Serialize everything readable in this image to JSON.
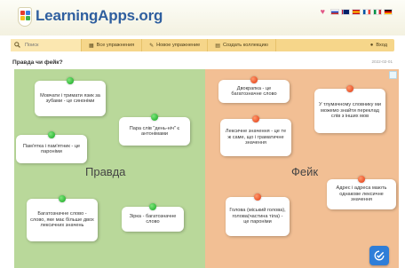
{
  "header": {
    "logo_text": "LearningApps.org",
    "languages": [
      "ru",
      "en",
      "es",
      "fr",
      "it",
      "de"
    ]
  },
  "toolbar": {
    "search_placeholder": "Поиск",
    "all_exercises": "Все упражнения",
    "new_exercise": "Новое упражнение",
    "create_collection": "Создать коллекцию",
    "login": "Вход"
  },
  "page": {
    "title": "Правда чи фейк?",
    "date": "2022-02-01"
  },
  "board": {
    "left_label": "Правда",
    "right_label": "Фейк",
    "cards": [
      {
        "text": "Мовчати і тримати язик за зубами - це синоніми",
        "pin": "green"
      },
      {
        "text": "Пам'ятка і пам'ятник - це пароніми",
        "pin": "green"
      },
      {
        "text": "Пара слів \"день-ніч\" є антонімами",
        "pin": "green"
      },
      {
        "text": "Багатозначне слово - слово, яке має більше двох лексичних значень",
        "pin": "green"
      },
      {
        "text": "Зірка - багатозначне слово",
        "pin": "green"
      },
      {
        "text": "Двокрапка - це багатозначне слово",
        "pin": "red"
      },
      {
        "text": "Лексичне значення - це те ж саме, що і граматичне значення",
        "pin": "red"
      },
      {
        "text": "У тлумачному словнику ми можемо знайти переклад слів з інших мов",
        "pin": "red"
      },
      {
        "text": "Адрес і адреса мають однакове лексичне значення",
        "pin": "red"
      },
      {
        "text": "Голова (міський голова), голова(частина тіла) - це пароніми",
        "pin": "red"
      }
    ]
  },
  "colors": {
    "true_zone": "#b9d89a",
    "fake_zone": "#f2bf94",
    "toolbar": "#f6d68a",
    "pin_green": "#13a51f",
    "pin_red": "#e0350f",
    "check_button": "#2f7ed8"
  },
  "icons": {
    "search": "search-icon",
    "grid": "grid-icon",
    "pencil": "pencil-icon",
    "collection": "collection-icon",
    "user": "user-icon",
    "check": "check-icon",
    "fullscreen": "fullscreen-icon"
  }
}
